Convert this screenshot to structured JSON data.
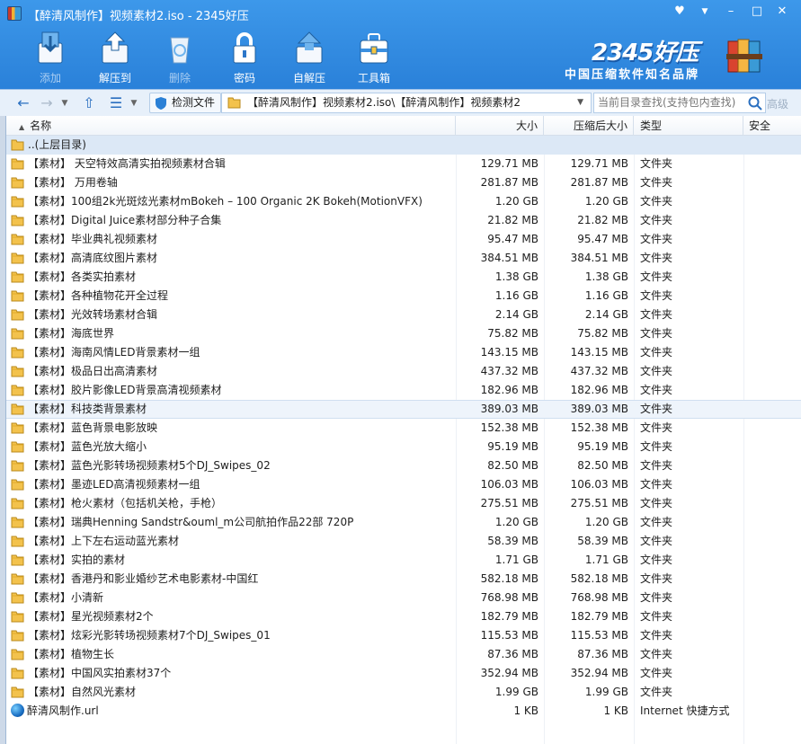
{
  "window": {
    "title": "【醉清风制作】视频素材2.iso - 2345好压"
  },
  "window_controls": {
    "skin": "♥",
    "menu": "▼",
    "minimize": "–",
    "maximize": "□",
    "close": "✕"
  },
  "toolbar": {
    "add": "添加",
    "extract": "解压到",
    "delete": "删除",
    "password": "密码",
    "sfx": "自解压",
    "tools": "工具箱"
  },
  "brand": {
    "logo": "2345好压",
    "slogan": "中国压缩软件知名品牌"
  },
  "address": {
    "check_files": "检测文件",
    "path": "【醉清风制作】视频素材2.iso\\【醉清风制作】视频素材2",
    "search_placeholder": "当前目录查找(支持包内查找)",
    "advanced": "高级"
  },
  "columns": {
    "name": "名称",
    "size": "大小",
    "compressed": "压缩后大小",
    "type": "类型",
    "security": "安全"
  },
  "parent_dir": "..(上层目录)",
  "files": [
    {
      "name": "【素材】 天空特效高清实拍视频素材合辑",
      "size": "129.71 MB",
      "comp": "129.71 MB",
      "type": "文件夹"
    },
    {
      "name": "【素材】 万用卷轴",
      "size": "281.87 MB",
      "comp": "281.87 MB",
      "type": "文件夹"
    },
    {
      "name": "【素材】100组2k光斑炫光素材mBokeh – 100 Organic 2K Bokeh(MotionVFX)",
      "size": "1.20 GB",
      "comp": "1.20 GB",
      "type": "文件夹"
    },
    {
      "name": "【素材】Digital Juice素材部分种子合集",
      "size": "21.82 MB",
      "comp": "21.82 MB",
      "type": "文件夹"
    },
    {
      "name": "【素材】毕业典礼视频素材",
      "size": "95.47 MB",
      "comp": "95.47 MB",
      "type": "文件夹"
    },
    {
      "name": "【素材】高清底纹图片素材",
      "size": "384.51 MB",
      "comp": "384.51 MB",
      "type": "文件夹"
    },
    {
      "name": "【素材】各类实拍素材",
      "size": "1.38 GB",
      "comp": "1.38 GB",
      "type": "文件夹"
    },
    {
      "name": "【素材】各种植物花开全过程",
      "size": "1.16 GB",
      "comp": "1.16 GB",
      "type": "文件夹"
    },
    {
      "name": "【素材】光效转场素材合辑",
      "size": "2.14 GB",
      "comp": "2.14 GB",
      "type": "文件夹"
    },
    {
      "name": "【素材】海底世界",
      "size": "75.82 MB",
      "comp": "75.82 MB",
      "type": "文件夹"
    },
    {
      "name": "【素材】海南风情LED背景素材一组",
      "size": "143.15 MB",
      "comp": "143.15 MB",
      "type": "文件夹"
    },
    {
      "name": "【素材】极品日出高清素材",
      "size": "437.32 MB",
      "comp": "437.32 MB",
      "type": "文件夹"
    },
    {
      "name": "【素材】胶片影像LED背景高清视频素材",
      "size": "182.96 MB",
      "comp": "182.96 MB",
      "type": "文件夹"
    },
    {
      "name": "【素材】科技类背景素材",
      "size": "389.03 MB",
      "comp": "389.03 MB",
      "type": "文件夹",
      "selected": true
    },
    {
      "name": "【素材】蓝色背景电影放映",
      "size": "152.38 MB",
      "comp": "152.38 MB",
      "type": "文件夹"
    },
    {
      "name": "【素材】蓝色光放大缩小",
      "size": "95.19 MB",
      "comp": "95.19 MB",
      "type": "文件夹"
    },
    {
      "name": "【素材】蓝色光影转场视频素材5个DJ_Swipes_02",
      "size": "82.50 MB",
      "comp": "82.50 MB",
      "type": "文件夹"
    },
    {
      "name": "【素材】墨迹LED高清视频素材一组",
      "size": "106.03 MB",
      "comp": "106.03 MB",
      "type": "文件夹"
    },
    {
      "name": "【素材】枪火素材（包括机关枪，手枪）",
      "size": "275.51 MB",
      "comp": "275.51 MB",
      "type": "文件夹"
    },
    {
      "name": "【素材】瑞典Henning Sandstr&ouml_m公司航拍作品22部 720P",
      "size": "1.20 GB",
      "comp": "1.20 GB",
      "type": "文件夹"
    },
    {
      "name": "【素材】上下左右运动蓝光素材",
      "size": "58.39 MB",
      "comp": "58.39 MB",
      "type": "文件夹"
    },
    {
      "name": "【素材】实拍的素材",
      "size": "1.71 GB",
      "comp": "1.71 GB",
      "type": "文件夹"
    },
    {
      "name": "【素材】香港丹和影业婚纱艺术电影素材-中国红",
      "size": "582.18 MB",
      "comp": "582.18 MB",
      "type": "文件夹"
    },
    {
      "name": "【素材】小清新",
      "size": "768.98 MB",
      "comp": "768.98 MB",
      "type": "文件夹"
    },
    {
      "name": "【素材】星光视频素材2个",
      "size": "182.79 MB",
      "comp": "182.79 MB",
      "type": "文件夹"
    },
    {
      "name": "【素材】炫彩光影转场视频素材7个DJ_Swipes_01",
      "size": "115.53 MB",
      "comp": "115.53 MB",
      "type": "文件夹"
    },
    {
      "name": "【素材】植物生长",
      "size": "87.36 MB",
      "comp": "87.36 MB",
      "type": "文件夹"
    },
    {
      "name": "【素材】中国风实拍素材37个",
      "size": "352.94 MB",
      "comp": "352.94 MB",
      "type": "文件夹"
    },
    {
      "name": "【素材】自然风光素材",
      "size": "1.99 GB",
      "comp": "1.99 GB",
      "type": "文件夹"
    }
  ],
  "url_file": {
    "name": "醉清风制作.url",
    "size": "1 KB",
    "comp": "1 KB",
    "type": "Internet 快捷方式"
  },
  "colors": {
    "title_blue": "#2b80d6",
    "folder_yellow": "#f3c24c",
    "selection": "#eef4fb"
  }
}
